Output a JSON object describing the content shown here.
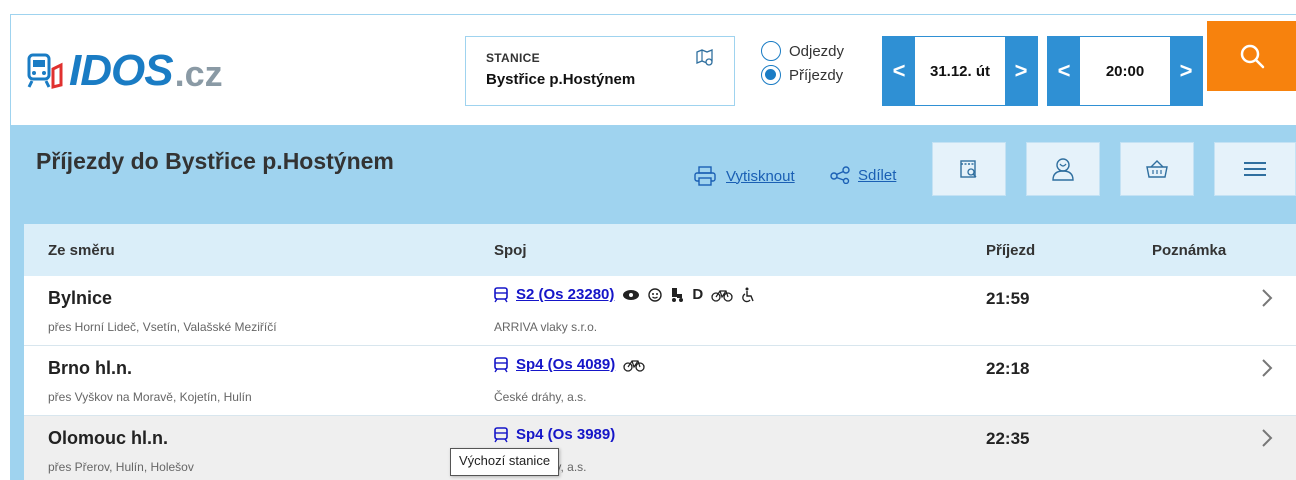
{
  "header": {
    "logo_text": "IDOS",
    "logo_tld": ".cz",
    "station_label": "STANICE",
    "station_value": "Bystřice p.Hostýnem",
    "radio_departures": "Odjezdy",
    "radio_arrivals": "Příjezdy",
    "selected_mode": "Příjezdy",
    "date_value": "31.12. út",
    "time_value": "20:00",
    "prev_arrow": "<",
    "next_arrow": ">"
  },
  "band": {
    "title": "Příjezdy do Bystřice p.Hostýnem",
    "print_label": "Vytisknout",
    "share_label": "Sdílet"
  },
  "table": {
    "columns": [
      "Ze směru",
      "Spoj",
      "Příjezd",
      "Poznámka"
    ],
    "rows": [
      {
        "from": "Bylnice",
        "via": "přes Horní Lideč, Vsetín, Valašské Meziříčí",
        "train": "S2 (Os 23280)",
        "train_icons": [
          "diner-icon",
          "wifi-icon",
          "stroller-icon",
          "D",
          "bicycle-icon",
          "wheelchair-icon"
        ],
        "carrier": "ARRIVA vlaky s.r.o.",
        "arrival": "21:59",
        "note": ""
      },
      {
        "from": "Brno hl.n.",
        "via": "přes Vyškov na Moravě, Kojetín, Hulín",
        "train": "Sp4 (Os 4089)",
        "train_icons": [
          "bicycle-icon"
        ],
        "carrier": "České dráhy, a.s.",
        "arrival": "22:18",
        "note": ""
      },
      {
        "from": "Olomouc hl.n.",
        "via": "přes Přerov, Hulín, Holešov",
        "train": "Sp4 (Os 3989)",
        "train_icons": [],
        "carrier": "České dráhy, a.s.",
        "arrival": "22:35",
        "note": ""
      }
    ]
  },
  "tooltip": "Výchozí stanice",
  "colors": {
    "brand_blue": "#1a7cc4",
    "band_blue": "#9fd3ef",
    "search_orange": "#f7820d",
    "link_blue": "#1515c8"
  }
}
